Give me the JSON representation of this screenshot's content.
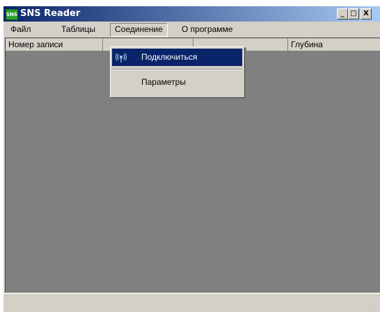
{
  "window": {
    "app_icon_text": "SNS",
    "title": "SNS Reader",
    "buttons": {
      "minimize": "_",
      "maximize": "□",
      "close": "X"
    }
  },
  "menubar": {
    "items": [
      {
        "label": "Файл"
      },
      {
        "label": "Таблицы"
      },
      {
        "label": "Соединение"
      },
      {
        "label": "О программе"
      }
    ]
  },
  "table": {
    "columns": [
      {
        "label": "Номер записи"
      },
      {
        "label": ""
      },
      {
        "label": ""
      },
      {
        "label": "Глубина"
      }
    ]
  },
  "dropdown": {
    "items": [
      {
        "label": "Подключиться",
        "icon": "antenna-icon",
        "highlighted": true
      },
      {
        "label": "Параметры",
        "icon": "",
        "highlighted": false
      }
    ]
  },
  "colors": {
    "title_gradient_start": "#0a246a",
    "title_gradient_end": "#a6caf0",
    "highlight": "#0a246a",
    "client_area": "#808080",
    "face": "#d4d0c8"
  }
}
